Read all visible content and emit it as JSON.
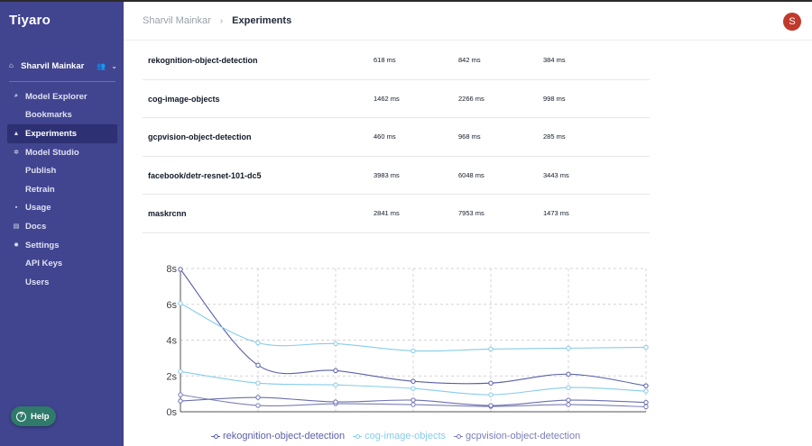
{
  "app": {
    "brand": "Tiyaro"
  },
  "sidebar": {
    "user_name": "Sharvil Mainkar",
    "items": [
      {
        "label": "Model Explorer",
        "icon": "search-icon",
        "glyph": "⌕",
        "sub": false,
        "active": false
      },
      {
        "label": "Bookmarks",
        "icon": "",
        "glyph": "",
        "sub": true,
        "active": false
      },
      {
        "label": "Experiments",
        "icon": "flask-icon",
        "glyph": "▲",
        "sub": false,
        "active": true
      },
      {
        "label": "Model Studio",
        "icon": "studio-icon",
        "glyph": "✲",
        "sub": false,
        "active": false
      },
      {
        "label": "Publish",
        "icon": "",
        "glyph": "",
        "sub": true,
        "active": false
      },
      {
        "label": "Retrain",
        "icon": "",
        "glyph": "",
        "sub": true,
        "active": false
      },
      {
        "label": "Usage",
        "icon": "chart-icon",
        "glyph": "▪",
        "sub": false,
        "active": false
      },
      {
        "label": "Docs",
        "icon": "doc-icon",
        "glyph": "▤",
        "sub": false,
        "active": false
      },
      {
        "label": "Settings",
        "icon": "gear-icon",
        "glyph": "✹",
        "sub": false,
        "active": false
      },
      {
        "label": "API Keys",
        "icon": "",
        "glyph": "",
        "sub": true,
        "active": false
      },
      {
        "label": "Users",
        "icon": "",
        "glyph": "",
        "sub": true,
        "active": false
      }
    ],
    "help_label": "Help"
  },
  "header": {
    "breadcrumb_user": "Sharvil Mainkar",
    "breadcrumb_sep": "›",
    "breadcrumb_page": "Experiments",
    "avatar_initial": "S"
  },
  "table": {
    "rows": [
      {
        "name": "rekognition-object-detection",
        "v1": "618 ms",
        "v2": "842 ms",
        "v3": "384 ms"
      },
      {
        "name": "cog-image-objects",
        "v1": "1462 ms",
        "v2": "2266 ms",
        "v3": "998 ms"
      },
      {
        "name": "gcpvision-object-detection",
        "v1": "460 ms",
        "v2": "968 ms",
        "v3": "285 ms"
      },
      {
        "name": "facebook/detr-resnet-101-dc5",
        "v1": "3983 ms",
        "v2": "6048 ms",
        "v3": "3443 ms"
      },
      {
        "name": "maskrcnn",
        "v1": "2841 ms",
        "v2": "7953 ms",
        "v3": "1473 ms"
      }
    ]
  },
  "chart_data": {
    "type": "line",
    "x": [
      1,
      2,
      3,
      4,
      5,
      6,
      7
    ],
    "y_ticks": [
      "0s",
      "2s",
      "4s",
      "6s",
      "8s"
    ],
    "ylim": [
      0,
      8000
    ],
    "grid": true,
    "legend_position": "bottom",
    "series": [
      {
        "name": "rekognition-object-detection",
        "color": "#5a5fa8",
        "values": [
          7950,
          2600,
          2300,
          1700,
          1600,
          2100,
          1450
        ],
        "in_legend": true
      },
      {
        "name": "cog-image-objects",
        "color": "#86ccea",
        "values": [
          6050,
          3850,
          3800,
          3400,
          3500,
          3550,
          3600
        ],
        "in_legend": true
      },
      {
        "name": "gcpvision-object-detection",
        "color": "#7a7eb8",
        "values": [
          950,
          350,
          450,
          400,
          300,
          400,
          280
        ],
        "in_legend": true
      },
      {
        "name": "",
        "color": "#86ccea",
        "values": [
          2250,
          1600,
          1500,
          1300,
          950,
          1350,
          1150
        ],
        "in_legend": false
      },
      {
        "name": "",
        "color": "#6a6fb0",
        "values": [
          600,
          800,
          550,
          650,
          350,
          650,
          520
        ],
        "in_legend": false
      }
    ]
  }
}
